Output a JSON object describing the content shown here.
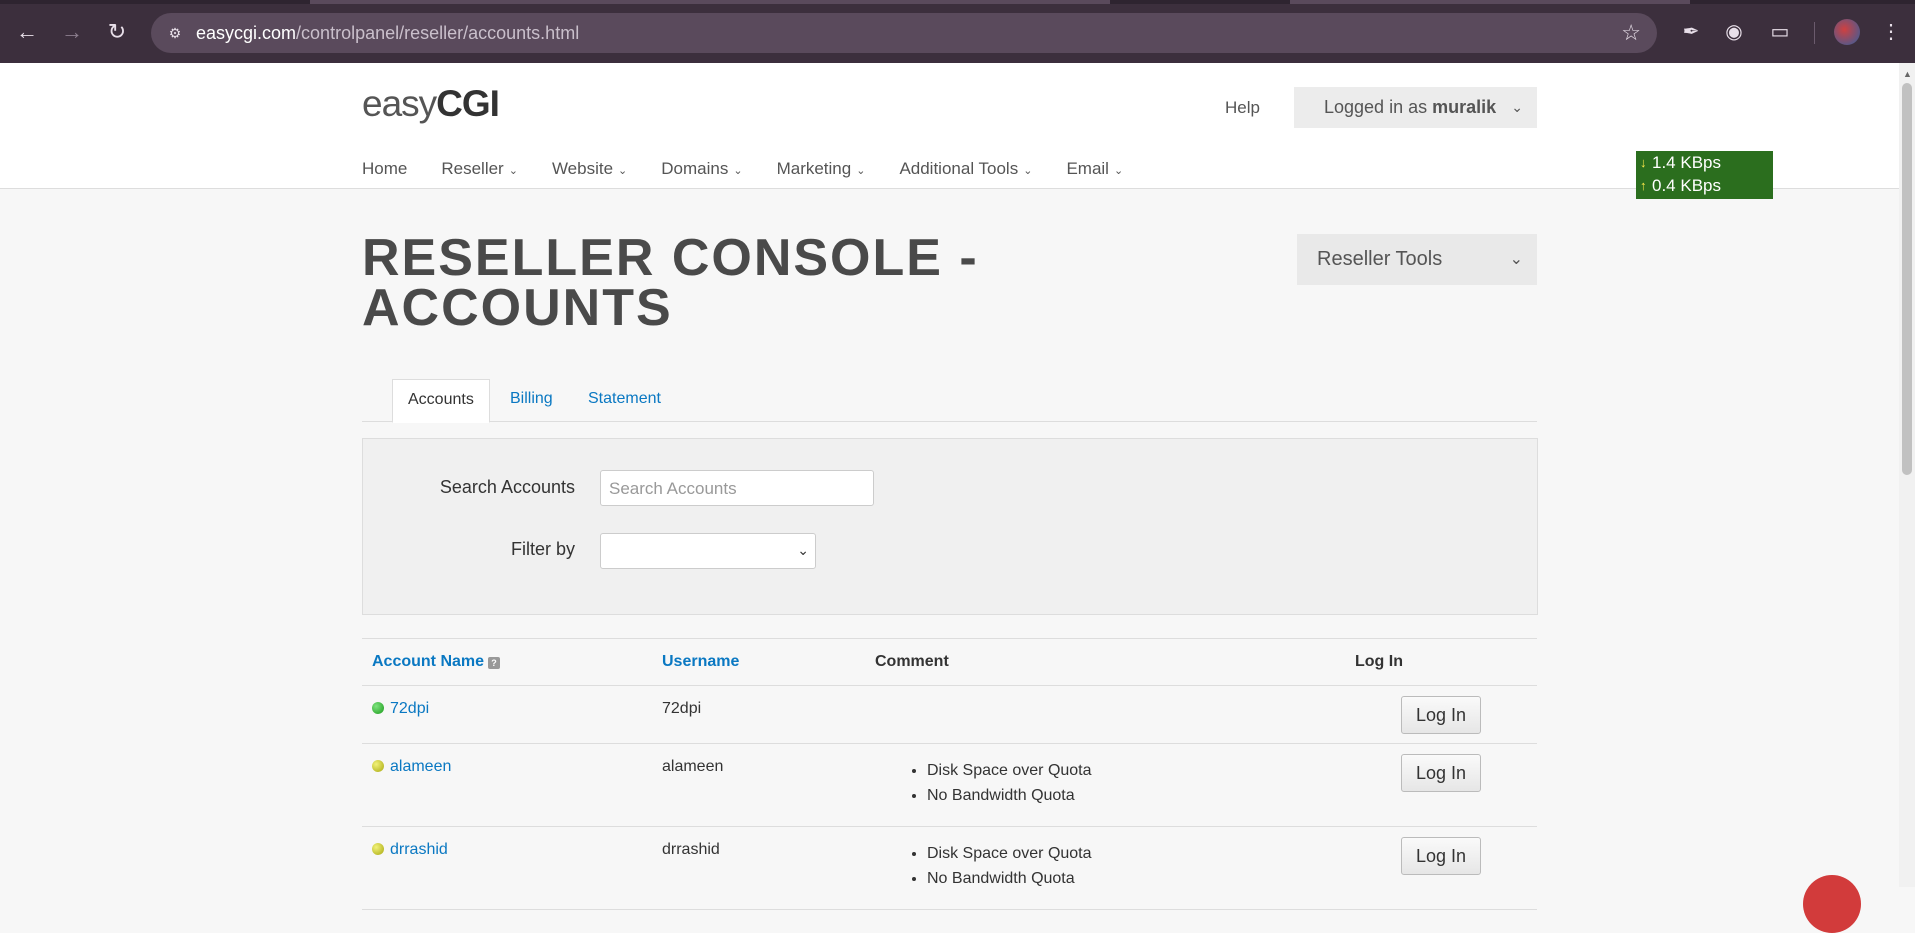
{
  "browser": {
    "url_host": "easycgi.com",
    "url_path": "/controlpanel/reseller/accounts.html",
    "icons": [
      "back-icon",
      "forward-icon",
      "reload-icon",
      "site-info-icon",
      "bookmark-star-icon",
      "eyedropper-icon",
      "camera-icon",
      "extensions-icon",
      "profile-avatar",
      "menu-icon"
    ]
  },
  "header": {
    "logo_light": "easy",
    "logo_bold": "CGI",
    "help": "Help",
    "logged_in_prefix": "Logged in as ",
    "username": "muralik",
    "nav": [
      "Home",
      "Reseller",
      "Website",
      "Domains",
      "Marketing",
      "Additional Tools",
      "Email"
    ]
  },
  "speed_widget": {
    "down": "1.4 KBps",
    "up": "0.4 KBps"
  },
  "page": {
    "title_line1": "RESELLER CONSOLE -",
    "title_line2": "ACCOUNTS",
    "tools_label": "Reseller Tools",
    "tabs": [
      "Accounts",
      "Billing",
      "Statement"
    ]
  },
  "search": {
    "label": "Search Accounts",
    "placeholder": "Search Accounts",
    "filter_label": "Filter by",
    "filter_value": ""
  },
  "table": {
    "headers": {
      "account_name": "Account Name",
      "username": "Username",
      "comment": "Comment",
      "log_in": "Log In"
    },
    "login_label": "Log In",
    "rows": [
      {
        "account": "72dpi",
        "username": "72dpi",
        "status": "green",
        "comments": []
      },
      {
        "account": "alameen",
        "username": "alameen",
        "status": "yellow",
        "comments": [
          "Disk Space over Quota",
          "No Bandwidth Quota"
        ]
      },
      {
        "account": "drrashid",
        "username": "drrashid",
        "status": "yellow",
        "comments": [
          "Disk Space over Quota",
          "No Bandwidth Quota"
        ]
      }
    ]
  },
  "colors": {
    "link": "#0a78c2",
    "chrome": "#3c2f3d",
    "speed_bg": "#2b6e1e"
  }
}
